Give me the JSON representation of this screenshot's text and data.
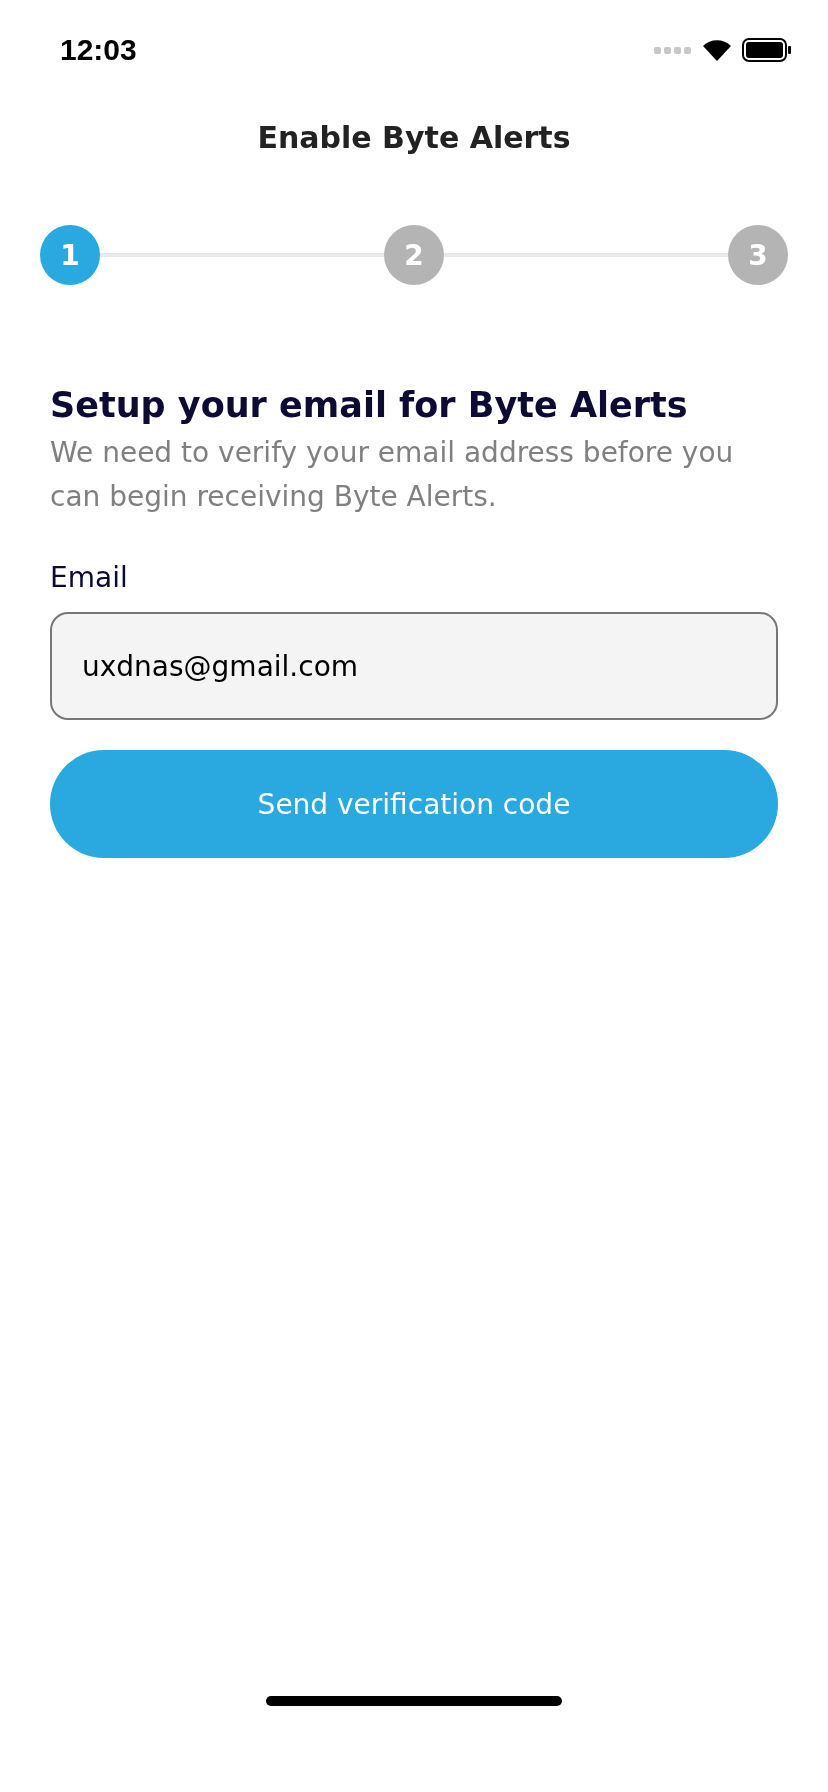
{
  "status_bar": {
    "time": "12:03"
  },
  "header": {
    "title": "Enable Byte Alerts"
  },
  "steps": [
    {
      "label": "1",
      "selected": true
    },
    {
      "label": "2",
      "selected": false
    },
    {
      "label": "3",
      "selected": false
    }
  ],
  "heading": "Setup your email for Byte Alerts",
  "description": "We need to verify your email address before you can begin receiving Byte Alerts.",
  "email": {
    "label": "Email",
    "value": "uxdnas@gmail.com"
  },
  "button": {
    "label": "Send verification code"
  }
}
